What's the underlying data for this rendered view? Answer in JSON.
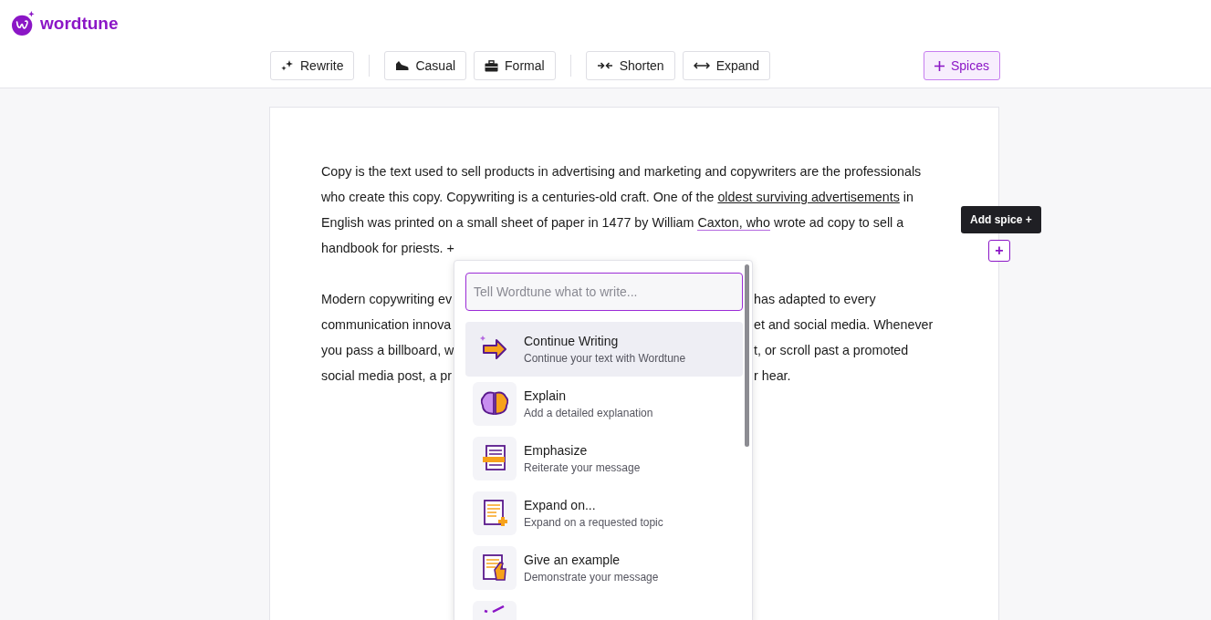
{
  "brand": {
    "name": "wordtune"
  },
  "toolbar": {
    "groups": [
      [
        {
          "label": "Rewrite",
          "selected": false
        }
      ],
      [
        {
          "label": "Casual",
          "selected": false
        },
        {
          "label": "Formal",
          "selected": false
        }
      ],
      [
        {
          "label": "Shorten",
          "selected": false
        },
        {
          "label": "Expand",
          "selected": false
        }
      ]
    ],
    "spices": {
      "label": "Spices",
      "selected": true
    }
  },
  "document": {
    "paragraph_1": [
      [
        {
          "kind": "plain",
          "text": "Copy is the text used to sell products in advertising and marketing and copywriters are the professionals"
        }
      ],
      [
        {
          "kind": "plain",
          "text": "who create this copy. Copywriting is a centuries-old craft. One of the "
        },
        {
          "kind": "link",
          "text": "oldest surviving advertisements"
        },
        {
          "kind": "plain",
          "text": " in"
        }
      ],
      [
        {
          "kind": "plain",
          "text": "English was printed on a small sheet of paper in 1477 by William "
        },
        {
          "kind": "highlight",
          "text": "Caxton, who"
        },
        {
          "kind": "plain",
          "text": " wrote ad copy to sell a"
        }
      ],
      [
        {
          "kind": "plain",
          "text": "handbook for priests."
        },
        {
          "kind": "marker",
          "text": "+"
        }
      ]
    ],
    "paragraph_2": [
      {
        "left": "Modern copywriting ev",
        "right": "has adapted to every"
      },
      {
        "left": "communication innova",
        "right": "et and social media. Whenever"
      },
      {
        "left": "you pass a billboard, w",
        "right": "t, or scroll past a promoted"
      },
      {
        "left": "social media post, a pr",
        "right": "r hear."
      }
    ]
  },
  "tooltip": {
    "text": "Add spice +"
  },
  "add_button": {
    "label": "+"
  },
  "spice_menu": {
    "placeholder": "Tell Wordtune what to write...",
    "items": [
      {
        "title": "Continue Writing",
        "subtitle": "Continue your text with Wordtune",
        "selected": true
      },
      {
        "title": "Explain",
        "subtitle": "Add a detailed explanation",
        "selected": false
      },
      {
        "title": "Emphasize",
        "subtitle": "Reiterate your message",
        "selected": false
      },
      {
        "title": "Expand on...",
        "subtitle": "Expand on a requested topic",
        "selected": false
      },
      {
        "title": "Give an example",
        "subtitle": "Demonstrate your message",
        "selected": false
      },
      {
        "selected": false
      }
    ]
  }
}
